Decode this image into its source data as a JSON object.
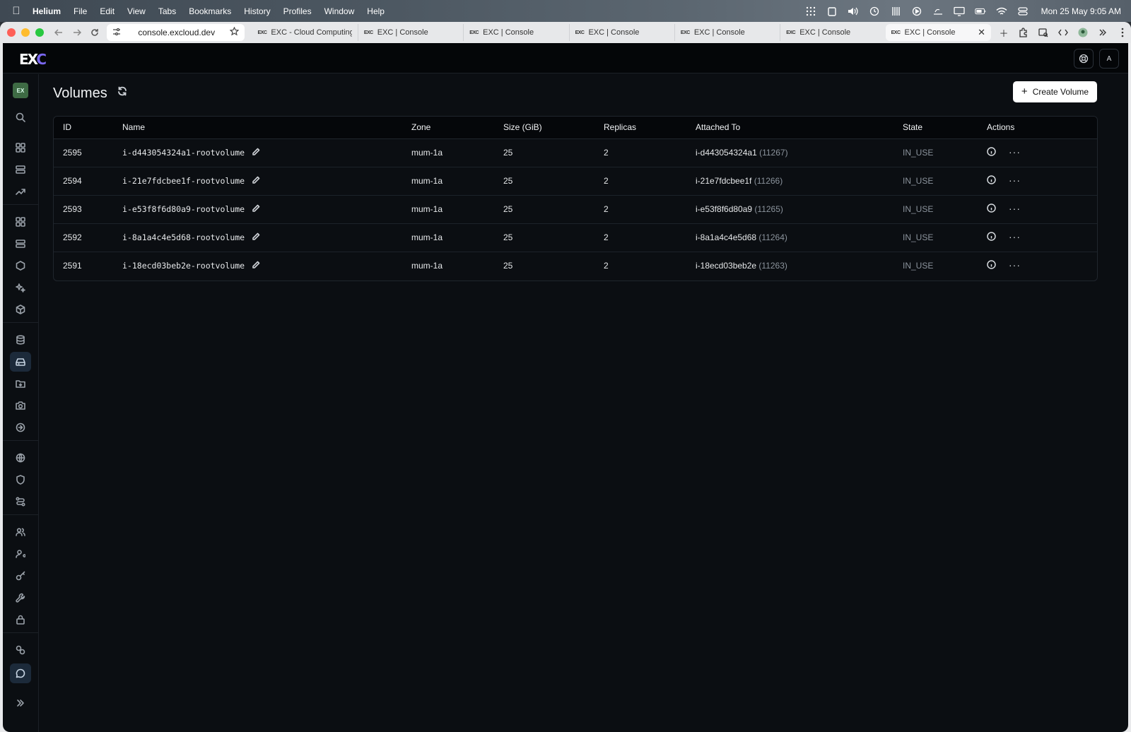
{
  "menubar": {
    "app_name": "Helium",
    "items": [
      "File",
      "Edit",
      "View",
      "Tabs",
      "Bookmarks",
      "History",
      "Profiles",
      "Window",
      "Help"
    ],
    "clock": "Mon 25 May  9:05 AM"
  },
  "browser": {
    "url": "console.excloud.dev",
    "tabs": [
      {
        "favicon": "EXC",
        "title": "EXC - Cloud Computing S"
      },
      {
        "favicon": "EXC",
        "title": "EXC | Console"
      },
      {
        "favicon": "EXC",
        "title": "EXC | Console"
      },
      {
        "favicon": "EXC",
        "title": "EXC | Console"
      },
      {
        "favicon": "EXC",
        "title": "EXC | Console"
      },
      {
        "favicon": "EXC",
        "title": "EXC | Console"
      },
      {
        "favicon": "EXC",
        "title": "EXC | Console"
      }
    ]
  },
  "app": {
    "logo_left": "EX",
    "logo_right": "C",
    "user_initial": "A",
    "org_badge": "EX"
  },
  "page": {
    "title": "Volumes",
    "create_button": "Create Volume"
  },
  "table": {
    "headers": {
      "id": "ID",
      "name": "Name",
      "zone": "Zone",
      "size": "Size (GiB)",
      "replicas": "Replicas",
      "attached": "Attached To",
      "state": "State",
      "actions": "Actions"
    },
    "rows": [
      {
        "id": "2595",
        "name": "i-d443054324a1-rootvolume",
        "zone": "mum-1a",
        "size": "25",
        "replicas": "2",
        "attached": "i-d443054324a1",
        "attached_id": "(11267)",
        "state": "IN_USE"
      },
      {
        "id": "2594",
        "name": "i-21e7fdcbee1f-rootvolume",
        "zone": "mum-1a",
        "size": "25",
        "replicas": "2",
        "attached": "i-21e7fdcbee1f",
        "attached_id": "(11266)",
        "state": "IN_USE"
      },
      {
        "id": "2593",
        "name": "i-e53f8f6d80a9-rootvolume",
        "zone": "mum-1a",
        "size": "25",
        "replicas": "2",
        "attached": "i-e53f8f6d80a9",
        "attached_id": "(11265)",
        "state": "IN_USE"
      },
      {
        "id": "2592",
        "name": "i-8a1a4c4e5d68-rootvolume",
        "zone": "mum-1a",
        "size": "25",
        "replicas": "2",
        "attached": "i-8a1a4c4e5d68",
        "attached_id": "(11264)",
        "state": "IN_USE"
      },
      {
        "id": "2591",
        "name": "i-18ecd03beb2e-rootvolume",
        "zone": "mum-1a",
        "size": "25",
        "replicas": "2",
        "attached": "i-18ecd03beb2e",
        "attached_id": "(11263)",
        "state": "IN_USE"
      }
    ]
  },
  "colors": {
    "background": "#0b0e12",
    "accent": "#7a67f0",
    "muted_text": "#8b939c",
    "active_nav": "#1c2a3a"
  }
}
